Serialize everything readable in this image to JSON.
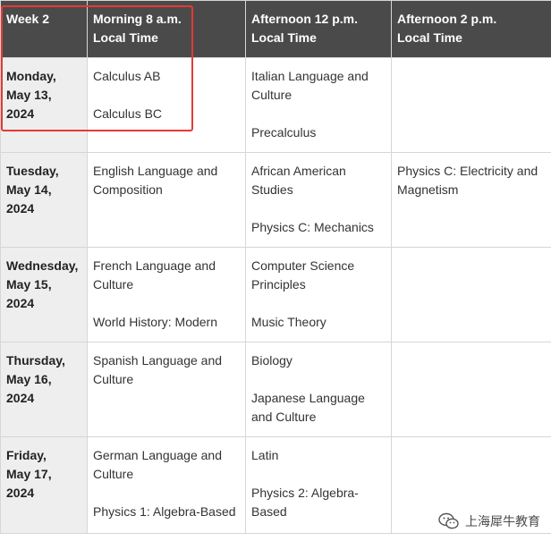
{
  "table": {
    "headers": [
      {
        "line1": "Week 2",
        "line2": ""
      },
      {
        "line1": "Morning 8 a.m.",
        "line2": "Local Time"
      },
      {
        "line1": "Afternoon 12 p.m.",
        "line2": "Local Time"
      },
      {
        "line1": "Afternoon 2 p.m.",
        "line2": "Local Time"
      }
    ],
    "rows": [
      {
        "day": "Monday,",
        "date": "May 13,",
        "year": "2024",
        "morning": [
          "Calculus AB",
          "Calculus BC"
        ],
        "noon": [
          "Italian Language and Culture",
          "Precalculus"
        ],
        "afternoon": []
      },
      {
        "day": "Tuesday,",
        "date": "May 14,",
        "year": "2024",
        "morning": [
          "English Language and Composition"
        ],
        "noon": [
          "African American Studies",
          "Physics C: Mechanics"
        ],
        "afternoon": [
          "Physics C: Electricity and Magnetism"
        ]
      },
      {
        "day": "Wednesday,",
        "date": "May 15,",
        "year": "2024",
        "morning": [
          "French Language and Culture",
          "World History: Modern"
        ],
        "noon": [
          "Computer Science Principles",
          "Music Theory"
        ],
        "afternoon": []
      },
      {
        "day": "Thursday,",
        "date": "May 16,",
        "year": "2024",
        "morning": [
          "Spanish Language and Culture"
        ],
        "noon": [
          "Biology",
          "Japanese Language and Culture"
        ],
        "afternoon": []
      },
      {
        "day": "Friday,",
        "date": "May 17,",
        "year": "2024",
        "morning": [
          "German Language and Culture",
          "Physics 1: Algebra-Based"
        ],
        "noon": [
          "Latin",
          "Physics 2: Algebra-Based"
        ],
        "afternoon": []
      }
    ]
  },
  "watermark": {
    "text": "上海犀牛教育",
    "icon": "wechat-icon"
  },
  "colors": {
    "header_bg": "#4a4a4a",
    "day_col_bg": "#eeeeee",
    "highlight": "#e53935"
  }
}
